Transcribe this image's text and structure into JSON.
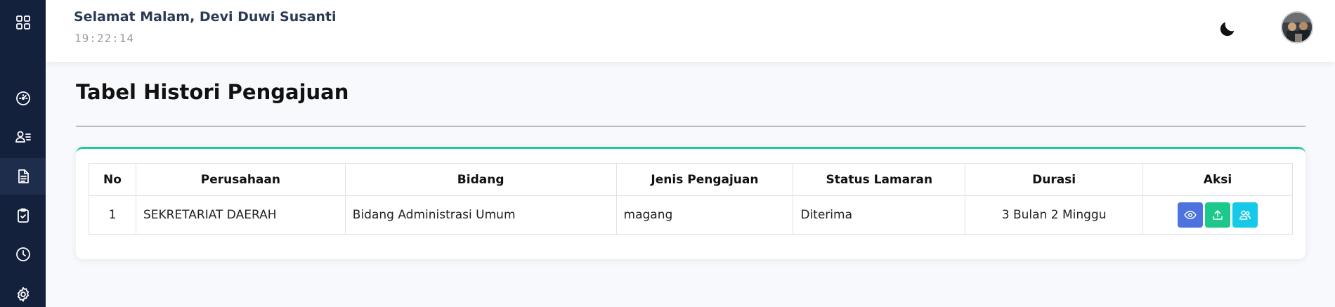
{
  "header": {
    "greeting": "Selamat Malam, Devi Duwi Susanti",
    "time": "19:22:14",
    "theme_icon": "moon-icon",
    "avatar_icon": "user-avatar"
  },
  "sidebar": {
    "items": [
      {
        "icon": "grid-menu-icon"
      },
      {
        "icon": "dashboard-icon"
      },
      {
        "icon": "user-list-icon"
      },
      {
        "icon": "document-icon",
        "active": true
      },
      {
        "icon": "clipboard-check-icon"
      },
      {
        "icon": "history-clock-icon"
      },
      {
        "icon": "gear-icon"
      }
    ]
  },
  "main": {
    "title": "Tabel Histori Pengajuan",
    "table": {
      "headers": {
        "no": "No",
        "perusahaan": "Perusahaan",
        "bidang": "Bidang",
        "jenis": "Jenis Pengajuan",
        "status": "Status Lamaran",
        "durasi": "Durasi",
        "aksi": "Aksi"
      },
      "rows": [
        {
          "no": "1",
          "perusahaan": "SEKRETARIAT DAERAH",
          "bidang": "Bidang Administrasi Umum",
          "jenis": "magang",
          "status": "Diterima",
          "durasi": "3 Bulan 2 Minggu"
        }
      ]
    },
    "actions": [
      {
        "icon": "eye-icon",
        "color": "#4e73df"
      },
      {
        "icon": "upload-icon",
        "color": "#1cc88a"
      },
      {
        "icon": "users-icon",
        "color": "#17c9e8"
      }
    ]
  },
  "colors": {
    "sidebar": "#14213d",
    "card_accent": "#20c997"
  }
}
